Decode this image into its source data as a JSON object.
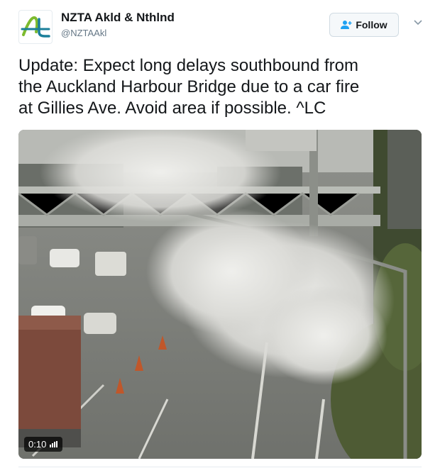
{
  "account": {
    "display_name": "NZTA Akld & Nthlnd",
    "handle": "@NZTAAkl"
  },
  "follow_button": {
    "label": "Follow"
  },
  "tweet": {
    "lines": [
      "Update: Expect long delays southbound from",
      "the Auckland Harbour Bridge due to a car fire",
      "at Gillies Ave.  Avoid area if possible. ^LC"
    ]
  },
  "media": {
    "type": "video",
    "timestamp": "0:10"
  },
  "colors": {
    "logo_green": "#7dbb2e",
    "logo_teal": "#1a7f9a",
    "follow_icon": "#1da1f2"
  },
  "icons": [
    "nzta-logo",
    "follow-person-plus-icon",
    "chevron-down-icon",
    "volume-bars-icon"
  ]
}
